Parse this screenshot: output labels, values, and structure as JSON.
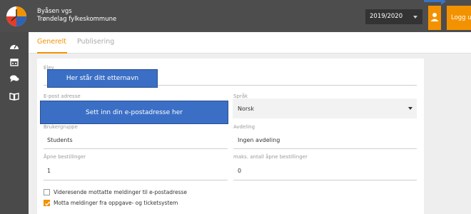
{
  "header": {
    "school_name": "Byåsen vgs",
    "municipality": "Trøndelag fylkeskommune",
    "year_selected": "2019/2020",
    "logout_label": "Logg ut",
    "accent_color": "#f39200"
  },
  "sidebar": {
    "icons": [
      "dashboard-icon",
      "calendar-icon",
      "chat-icon",
      "book-icon"
    ]
  },
  "tabs": [
    {
      "label": "Generelt",
      "active": true
    },
    {
      "label": "Publisering",
      "active": false
    }
  ],
  "form": {
    "elev_label": "Elev",
    "email_label": "E-post adresse",
    "language_label": "Språk",
    "language_value": "Norsk",
    "usergroup_label": "Brukergruppe",
    "usergroup_value": "Students",
    "department_label": "Avdeling",
    "department_value": "Ingen avdeling",
    "open_orders_label": "Åpne bestillinger",
    "open_orders_value": "1",
    "max_open_orders_label": "maks. antall åpne bestillinger",
    "max_open_orders_value": "0",
    "forward_email_label": "Videresende mottatte meldinger til e-postadresse",
    "forward_email_checked": false,
    "receive_messages_label": "Motta meldinger fra oppgave- og ticketsystem",
    "receive_messages_checked": true
  },
  "annotations": {
    "lastname_note": "Her står ditt etternavn",
    "email_note": "Sett inn din e-postadresse her"
  }
}
